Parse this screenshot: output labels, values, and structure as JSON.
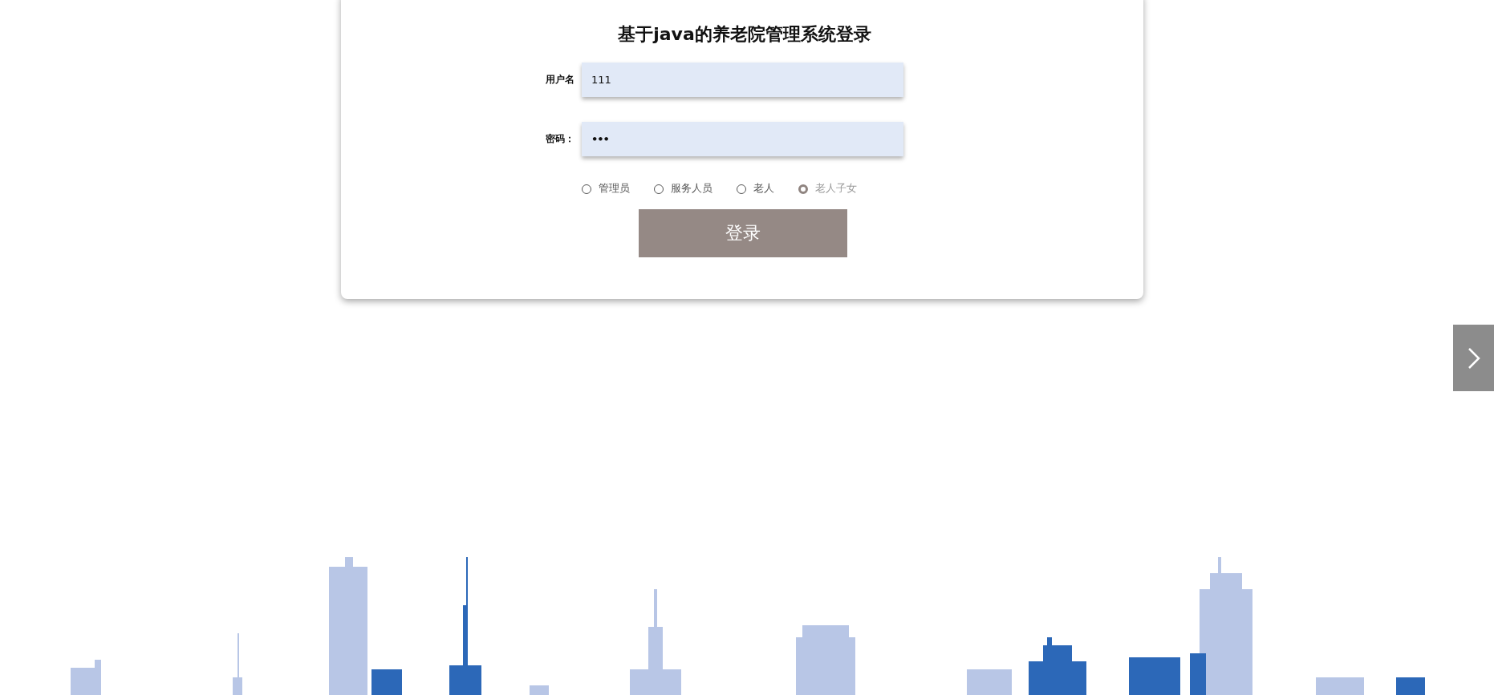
{
  "title": "基于java的养老院管理系统登录",
  "fields": [
    {
      "label": "用户名",
      "value": "111",
      "kind": "text"
    },
    {
      "label": "密码：",
      "value": "•••",
      "kind": "password"
    }
  ],
  "roles": [
    {
      "label": "管理员",
      "selected": false
    },
    {
      "label": "服务人员",
      "selected": false
    },
    {
      "label": "老人",
      "selected": false
    },
    {
      "label": "老人子女",
      "selected": true
    }
  ],
  "login_button": "登录"
}
